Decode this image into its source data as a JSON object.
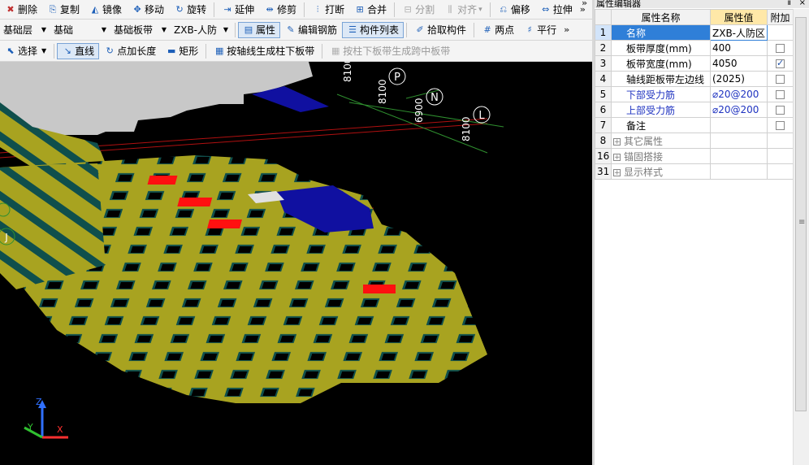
{
  "toolbar1": {
    "items": [
      {
        "label": "删除",
        "icon": "delete-icon"
      },
      {
        "label": "复制",
        "icon": "copy-icon"
      },
      {
        "label": "镜像",
        "icon": "mirror-icon"
      },
      {
        "label": "移动",
        "icon": "move-icon"
      },
      {
        "label": "旋转",
        "icon": "rotate-icon"
      },
      {
        "label": "延伸",
        "icon": "extend-icon"
      },
      {
        "label": "修剪",
        "icon": "trim-icon"
      },
      {
        "label": "打断",
        "icon": "break-icon"
      },
      {
        "label": "合并",
        "icon": "merge-icon"
      },
      {
        "label": "分割",
        "icon": "split-icon",
        "disabled": true
      },
      {
        "label": "对齐",
        "icon": "align-icon",
        "disabled": true,
        "dropdown": true
      },
      {
        "label": "偏移",
        "icon": "offset-icon"
      },
      {
        "label": "拉伸",
        "icon": "stretch-icon"
      }
    ],
    "more": "»"
  },
  "toolbar2": {
    "combos": [
      {
        "value": "基础层"
      },
      {
        "value": "基础"
      },
      {
        "value": "基础板带"
      },
      {
        "value": "ZXB-人防"
      }
    ],
    "buttons": [
      {
        "label": "属性",
        "icon": "property-icon",
        "active": true
      },
      {
        "label": "编辑钢筋",
        "icon": "edit-rebar-icon"
      },
      {
        "label": "构件列表",
        "icon": "component-list-icon",
        "active": true
      },
      {
        "label": "拾取构件",
        "icon": "pick-icon"
      },
      {
        "label": "两点",
        "icon": "two-point-axis-icon"
      },
      {
        "label": "平行",
        "icon": "parallel-axis-icon"
      }
    ],
    "more": "»"
  },
  "toolbar3": {
    "select_label": "选择",
    "buttons": [
      {
        "label": "直线",
        "icon": "line-icon",
        "active": true
      },
      {
        "label": "点加长度",
        "icon": "point-length-icon"
      },
      {
        "label": "矩形",
        "icon": "rectangle-icon"
      },
      {
        "label": "按轴线生成柱下板带",
        "icon": "axis-strip-icon"
      },
      {
        "label": "按柱下板带生成跨中板带",
        "icon": "mid-strip-icon",
        "disabled": true
      }
    ]
  },
  "viewport": {
    "axis_labels": [
      "P",
      "N",
      "L"
    ],
    "dimensions": [
      "8100",
      "8100",
      "6900",
      "8100"
    ],
    "left_axis_labels": [
      "J"
    ],
    "coord": {
      "x": "X",
      "y": "Y",
      "z": "Z"
    },
    "colors": {
      "background": "#000000",
      "slab": "#a8a320",
      "edge": "#0f4f4c",
      "highlight": "#ff1010",
      "blue_region": "#1010a0",
      "gray_region": "#c8c8c8",
      "axis_line": "#b01010",
      "grid_green": "#2f8f2f"
    }
  },
  "panel": {
    "title": "属性编辑器",
    "headers": {
      "idx": "",
      "name": "属性名称",
      "value": "属性值",
      "extra": "附加"
    },
    "rows": [
      {
        "idx": "1",
        "name": "名称",
        "value": "ZXB-人防区",
        "checkbox": null,
        "selected": true,
        "style": "normal"
      },
      {
        "idx": "2",
        "name": "板带厚度(mm)",
        "value": "400",
        "checkbox": false,
        "style": "normal"
      },
      {
        "idx": "3",
        "name": "板带宽度(mm)",
        "value": "4050",
        "checkbox": true,
        "style": "normal"
      },
      {
        "idx": "4",
        "name": "轴线距板带左边线",
        "value": "(2025)",
        "checkbox": false,
        "style": "normal"
      },
      {
        "idx": "5",
        "name": "下部受力筋",
        "value": "⌀20@200",
        "checkbox": false,
        "style": "blue"
      },
      {
        "idx": "6",
        "name": "上部受力筋",
        "value": "⌀20@200",
        "checkbox": false,
        "style": "blue"
      },
      {
        "idx": "7",
        "name": "备注",
        "value": "",
        "checkbox": false,
        "style": "normal"
      },
      {
        "idx": "8",
        "name": "其它属性",
        "value": "",
        "checkbox": null,
        "style": "group"
      },
      {
        "idx": "16",
        "name": "锚固搭接",
        "value": "",
        "checkbox": null,
        "style": "group"
      },
      {
        "idx": "31",
        "name": "显示样式",
        "value": "",
        "checkbox": null,
        "style": "group"
      }
    ],
    "expand_symbol": "+",
    "pin": "ⅱ",
    "close": "×",
    "collapse_chev": "»"
  }
}
